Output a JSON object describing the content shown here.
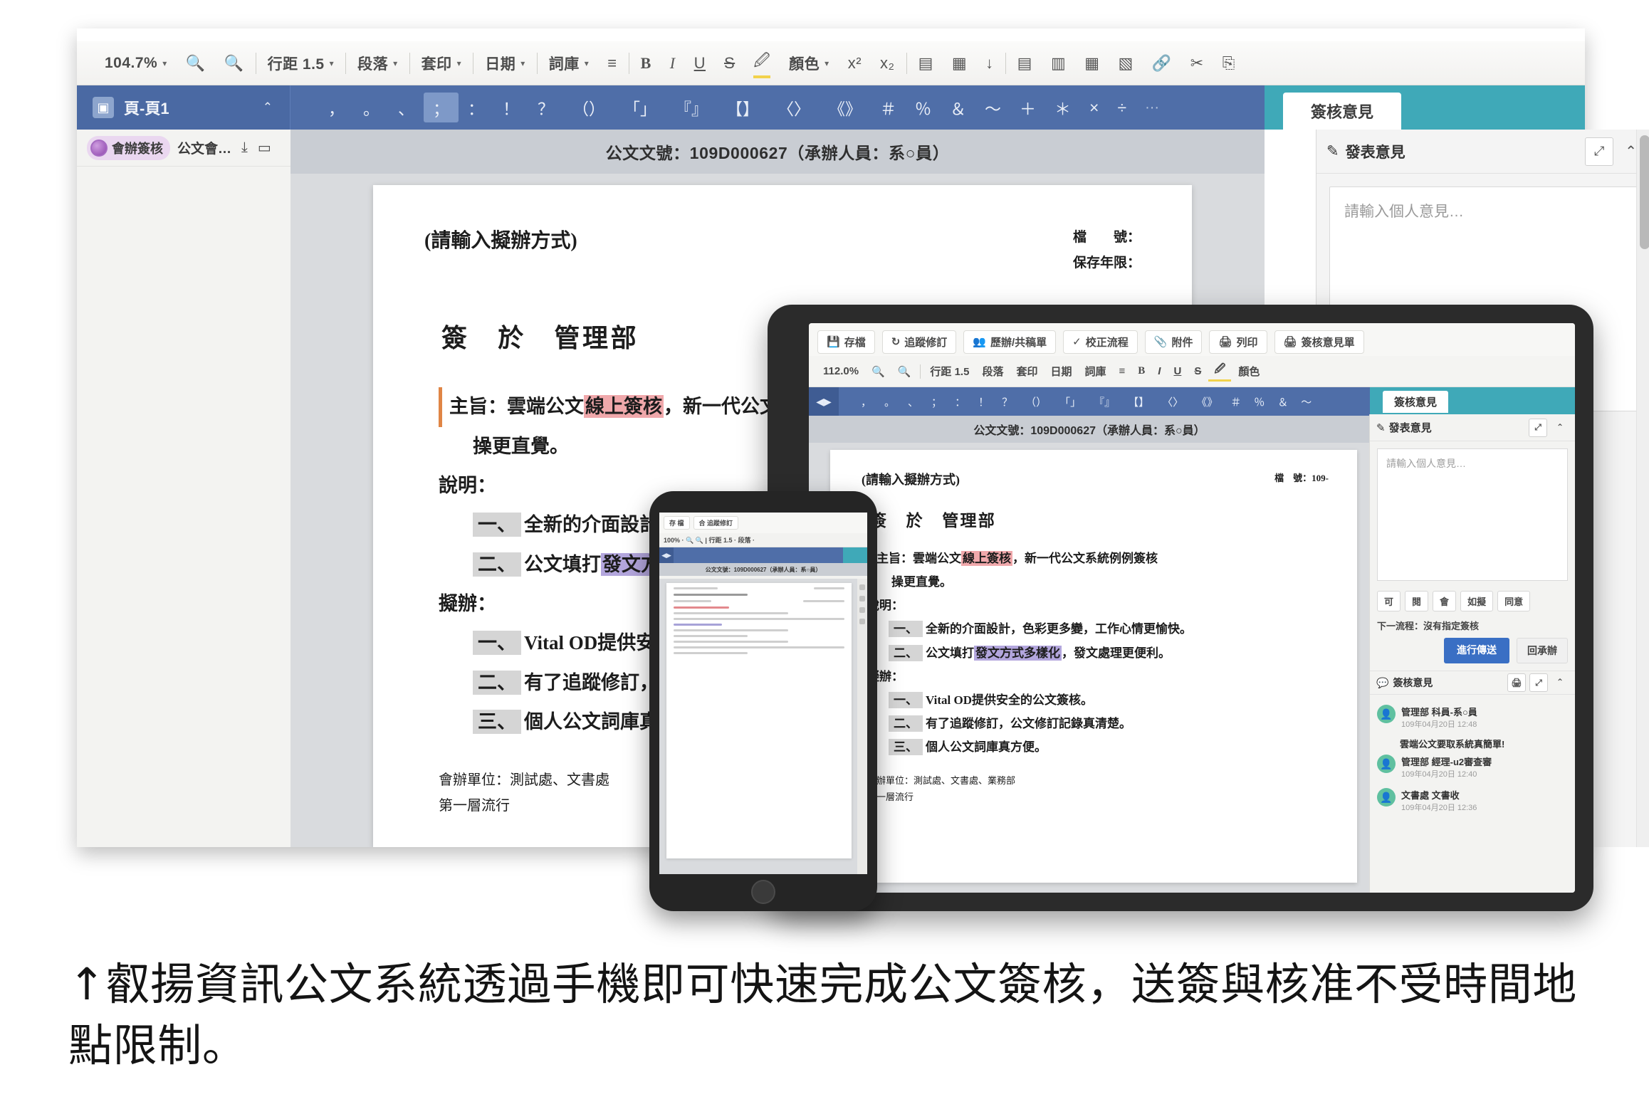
{
  "desktop": {
    "toolbar": {
      "zoom": "104.7%",
      "items": [
        {
          "label": "行距 1.5",
          "caret": true
        },
        {
          "label": "段落",
          "caret": true
        },
        {
          "label": "套印",
          "caret": true
        },
        {
          "label": "日期",
          "caret": true
        },
        {
          "label": "詞庫",
          "caret": true
        }
      ],
      "icons": {
        "zoom_out": "🔍",
        "zoom_in": "🔍",
        "list": "≡",
        "bold": "B",
        "italic": "I",
        "underline": "U",
        "strike": "S",
        "highlighter": "🖉",
        "color_label": "顏色",
        "superscript": "x²",
        "subscript": "x₂",
        "table1": "▤",
        "table2": "▦",
        "down": "↓",
        "align_left": "▤",
        "align_center": "▥",
        "align_right": "▦",
        "align_just": "▧",
        "link": "🔗",
        "cut": "✂",
        "paste": "⎘"
      }
    },
    "tab": {
      "label": "頁-頁1",
      "icon": "▣",
      "chevron": "⌃"
    },
    "punctuation": [
      "，",
      "。",
      "、",
      "；",
      "：",
      "！",
      "？",
      "（）",
      "「」",
      "『』",
      "【】",
      "〈〉",
      "《》",
      "＃",
      "％",
      "＆",
      "～",
      "＋",
      "＊",
      "×",
      "÷"
    ],
    "punctuation_selected": "；",
    "punctuation_more": "···",
    "sidebar": {
      "pill_label": "會辦簽核",
      "second_label": "公文會…",
      "icons": [
        "download-icon",
        "layout-icon"
      ]
    },
    "doc_band": "公文文號：109D000627（承辦人員：系○員）",
    "document": {
      "top_left": "(請輸入擬辦方式)",
      "meta": [
        "檔　　號：",
        "保存年限："
      ],
      "sign_line": "簽　於　管理部",
      "subject_label": "主旨：",
      "subject_pre": "雲端公文",
      "subject_hl": "線上簽核",
      "subject_post": "，新一代公文系統例例簽核",
      "subject_line2": "操更直覺。",
      "explain_label": "說明：",
      "explain_items": [
        {
          "num": "一、",
          "pre": "全新的介面設計",
          "hl": "",
          "post": "，色彩更多變，工作心情更愉快"
        },
        {
          "num": "二、",
          "pre": "公文填打",
          "hl": "發文方式多樣化",
          "post": "，發文處理更便利。"
        }
      ],
      "proposal_label": "擬辦：",
      "proposal_items": [
        {
          "num": "一、",
          "text": "Vital OD提供安全的公文簽核。"
        },
        {
          "num": "二、",
          "text": "有了追蹤修訂，公文修訂記錄真清楚。"
        },
        {
          "num": "三、",
          "text": "個人公文詞庫真方便。"
        }
      ],
      "footer": [
        "會辦單位：測試處、文書處",
        "第一層流行"
      ]
    },
    "comments": {
      "tab_label": "簽核意見",
      "post_label": "發表意見",
      "post_icon": "✎",
      "expand_icon": "⤢",
      "collapse_icon": "⌃",
      "placeholder": "請輸入個人意見…"
    }
  },
  "tablet": {
    "toolbar_buttons": [
      {
        "icon": "💾",
        "label": "存檔"
      },
      {
        "icon": "↻",
        "label": "追蹤修訂"
      },
      {
        "icon": "👥",
        "label": "歷辦/共稿單"
      },
      {
        "icon": "✓",
        "label": "校正流程"
      },
      {
        "icon": "📎",
        "label": "附件"
      },
      {
        "icon": "🖨",
        "label": "列印"
      },
      {
        "icon": "🖨",
        "label": "簽核意見單"
      }
    ],
    "format_bar": {
      "zoom": "112.0%",
      "items": [
        "行距 1.5",
        "段落",
        "套印",
        "日期",
        "詞庫"
      ],
      "bold": "B",
      "italic": "I",
      "underline": "U",
      "strike": "S",
      "color_label": "顏色"
    },
    "punctuation": [
      "，",
      "。",
      "、",
      "；",
      "：",
      "！",
      "？",
      "（）",
      "「」",
      "『』",
      "【】",
      "〈〉",
      "《》",
      "＃",
      "％",
      "＆",
      "～"
    ],
    "comments_tab": "簽核意見",
    "doc_band": "公文文號：109D000627（承辦人員：系○員）",
    "document": {
      "top_left": "(請輸入擬辦方式)",
      "meta_right": "檔　號：109-",
      "sign_line": "簽　於　管理部",
      "subject_label": "主旨：",
      "subject_pre": "雲端公文",
      "subject_hl": "線上簽核",
      "subject_post": "，新一代公文系統例例簽核",
      "subject_line2": "操更直覺。",
      "explain_label": "說明：",
      "explain_items": [
        {
          "num": "一、",
          "pre": "全新的介面設計，色彩更多變，工作心情更愉快。",
          "hl": "",
          "post": ""
        },
        {
          "num": "二、",
          "pre": "公文填打",
          "hl": "發文方式多樣化",
          "post": "，發文處理更便利。"
        }
      ],
      "proposal_label": "擬辦：",
      "proposal_items": [
        {
          "num": "一、",
          "text": "Vital OD提供安全的公文簽核。"
        },
        {
          "num": "二、",
          "text": "有了追蹤修訂，公文修訂記錄真清楚。"
        },
        {
          "num": "三、",
          "text": "個人公文詞庫真方便。"
        }
      ],
      "footer": [
        "會辦單位：測試處、文書處、業務部",
        "第一層流行"
      ]
    },
    "side": {
      "post_label": "發表意見",
      "placeholder": "請輸入個人意見…",
      "chips": [
        "可",
        "閱",
        "會",
        "如擬",
        "同意"
      ],
      "next_flow": "下一流程：沒有指定簽核",
      "primary_btn": "進行傳送",
      "ghost_btn": "回承辦",
      "section_title": "簽核意見",
      "comments": [
        {
          "name": "管理部 科員-系○員",
          "time": "109年04月20日  12:48",
          "msg": "雲端公文要取系統真簡單!"
        },
        {
          "name": "管理部 經理-u2審查審",
          "time": "109年04月20日  12:40",
          "msg": ""
        },
        {
          "name": "文書處 文書收",
          "time": "109年04月20日  12:36",
          "msg": ""
        }
      ]
    }
  },
  "phone": {
    "buttons": [
      "存 檔",
      "合 追蹤修訂"
    ],
    "format_bar": "100% · 🔍 🔍 | 行距 1.5 · 段落 ·",
    "doc_band": "公文文號：109D000627（承辦人員：系○員）"
  },
  "caption": {
    "arrow": "↑",
    "text": "叡揚資訊公文系統透過手機即可快速完成公文簽核，送簽與核准不受時間地點限制。"
  },
  "colors": {
    "toolbar_blue": "#4f6ea8",
    "teal": "#3fa9b8",
    "highlight_red": "#f0a8ab",
    "highlight_purple": "#b3a6dd",
    "primary_button": "#3a6fc4",
    "avatar_green": "#5fc0a0"
  }
}
